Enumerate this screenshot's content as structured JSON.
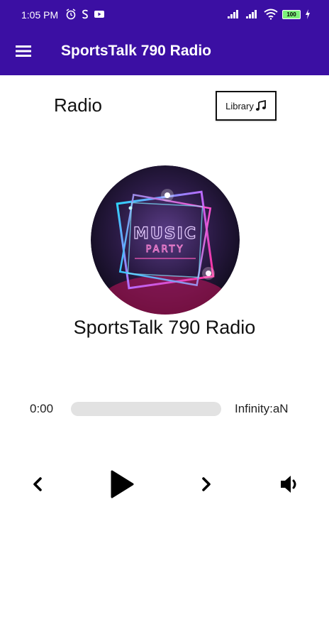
{
  "status_bar": {
    "time": "1:05 PM",
    "battery": "100"
  },
  "app_bar": {
    "title": "SportsTalk 790 Radio",
    "menu_icon": "hamburger-menu-icon"
  },
  "page": {
    "heading": "Radio",
    "library_button_label": "Library"
  },
  "artwork": {
    "title_text": "MUSIC",
    "subtitle_text": "PARTY"
  },
  "station": {
    "name": "SportsTalk 790 Radio"
  },
  "player": {
    "current_time": "0:00",
    "total_time": "Infinity:aN",
    "progress": 0
  },
  "controls": {
    "previous_icon": "chevron-left-icon",
    "play_icon": "play-icon",
    "next_icon": "chevron-right-icon",
    "volume_icon": "volume-icon"
  },
  "colors": {
    "primary": "#3b0fa3",
    "track": "#e2e2e2"
  }
}
